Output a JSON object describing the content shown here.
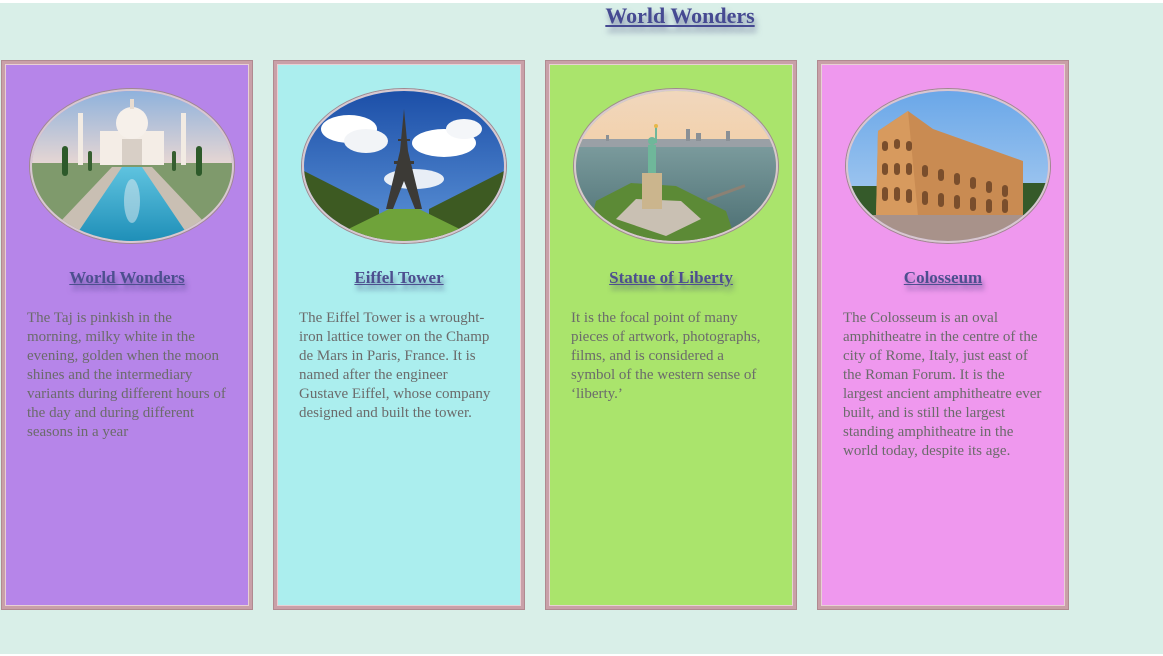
{
  "page": {
    "title": "World Wonders"
  },
  "cards": [
    {
      "title": "World Wonders",
      "image": "taj-mahal-photo",
      "background": "#b685e9",
      "text": "The Taj is pinkish in the morning, milky white in the evening, golden when the moon shines and the intermediary variants during different hours of the day and during different seasons in a year"
    },
    {
      "title": "Eiffel Tower",
      "image": "eiffel-tower-photo",
      "background": "#abeeee",
      "text": "The Eiffel Tower is a wrought-iron lattice tower on the Champ de Mars in Paris, France. It is named after the engineer Gustave Eiffel, whose company designed and built the tower."
    },
    {
      "title": "Statue of Liberty",
      "image": "statue-of-liberty-photo",
      "background": "#aae46c",
      "text": "It is the focal point of many pieces of artwork, photographs, films, and is considered a symbol of the western sense of ‘liberty.’"
    },
    {
      "title": "Colosseum",
      "image": "colosseum-photo",
      "background": "#ef98ee",
      "text": "The Colosseum is an oval amphitheatre in the centre of the city of Rome, Italy, just east of the Roman Forum. It is the largest ancient amphitheatre ever built, and is still the largest standing amphitheatre in the world today, despite its age."
    }
  ],
  "colors": {
    "page_background": "#d9efe8",
    "title_color": "#464a92",
    "card_border": "#c9a0a8"
  }
}
